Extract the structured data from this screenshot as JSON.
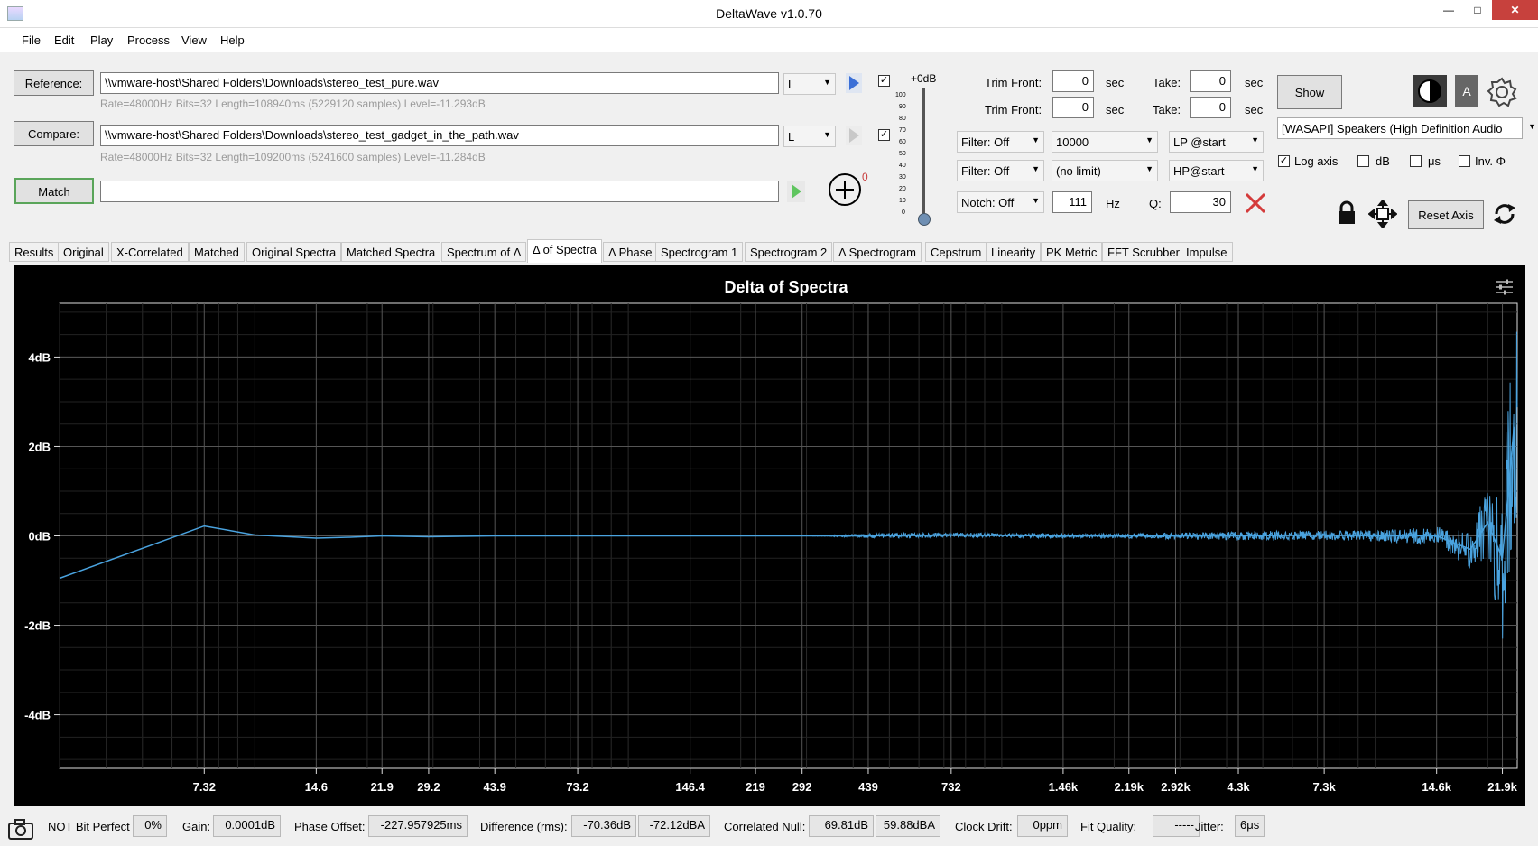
{
  "window": {
    "title": "DeltaWave v1.0.70",
    "minimize": "—",
    "maximize": "□",
    "close": "✕"
  },
  "menu": [
    "File",
    "Edit",
    "Play",
    "Process",
    "View",
    "Help"
  ],
  "reference": {
    "button": "Reference:",
    "path": "\\\\vmware-host\\Shared Folders\\Downloads\\stereo_test_pure.wav",
    "info": "Rate=48000Hz Bits=32 Length=108940ms (5229120 samples) Level=-11.293dB",
    "channel": "L"
  },
  "compare": {
    "button": "Compare:",
    "path": "\\\\vmware-host\\Shared Folders\\Downloads\\stereo_test_gadget_in_the_path.wav",
    "info": "Rate=48000Hz Bits=32 Length=109200ms (5241600 samples) Level=-11.284dB",
    "channel": "L"
  },
  "match": {
    "button": "Match",
    "counter": "0"
  },
  "level": {
    "label": "+0dB",
    "ticks": [
      "100",
      "90",
      "80",
      "70",
      "60",
      "50",
      "40",
      "30",
      "20",
      "10",
      "0"
    ]
  },
  "trim": {
    "rows": [
      {
        "trim_label": "Trim Front:",
        "trim_value": "0",
        "unit": "sec",
        "take_label": "Take:",
        "take_value": "0",
        "take_unit": "sec"
      },
      {
        "trim_label": "Trim Front:",
        "trim_value": "0",
        "unit": "sec",
        "take_label": "Take:",
        "take_value": "0",
        "take_unit": "sec"
      }
    ]
  },
  "filters": {
    "filter1": "Filter: Off",
    "freq1": "10000",
    "mode1": "LP @start",
    "filter2": "Filter: Off",
    "freq2": "(no limit)",
    "mode2": "HP@start",
    "notch": "Notch: Off",
    "notch_freq": "111",
    "hz": "Hz",
    "q_label": "Q:",
    "q_value": "30"
  },
  "right_panel": {
    "show_button": "Show",
    "a_button": "A",
    "device": "[WASAPI] Speakers (High Definition Audio",
    "log_axis": "Log axis",
    "db": "dB",
    "us": "μs",
    "inv": "Inv. Φ",
    "reset_axis": "Reset Axis"
  },
  "tabs": [
    "Results",
    "Original",
    "X-Correlated",
    "Matched",
    "Original Spectra",
    "Matched Spectra",
    "Spectrum of Δ",
    "Δ of Spectra",
    "Δ Phase",
    "Spectrogram 1",
    "Spectrogram 2",
    "Δ Spectrogram",
    "Cepstrum",
    "Linearity",
    "PK Metric",
    "FFT Scrubber",
    "Impulse"
  ],
  "active_tab": "Δ of Spectra",
  "chart_data": {
    "type": "line",
    "title": "Delta of Spectra",
    "x_scale": "log",
    "xlim": [
      3,
      24000
    ],
    "ylim": [
      -5.2,
      5.2
    ],
    "y_ticks": [
      {
        "v": 4,
        "label": "4dB"
      },
      {
        "v": 2,
        "label": "2dB"
      },
      {
        "v": 0,
        "label": "0dB"
      },
      {
        "v": -2,
        "label": "-2dB"
      },
      {
        "v": -4,
        "label": "-4dB"
      }
    ],
    "x_ticks": [
      {
        "v": 7.32,
        "label": "7.32"
      },
      {
        "v": 14.6,
        "label": "14.6"
      },
      {
        "v": 21.9,
        "label": "21.9"
      },
      {
        "v": 29.2,
        "label": "29.2"
      },
      {
        "v": 43.9,
        "label": "43.9"
      },
      {
        "v": 73.2,
        "label": "73.2"
      },
      {
        "v": 146.4,
        "label": "146.4"
      },
      {
        "v": 219,
        "label": "219"
      },
      {
        "v": 292,
        "label": "292"
      },
      {
        "v": 439,
        "label": "439"
      },
      {
        "v": 732,
        "label": "732"
      },
      {
        "v": 1460,
        "label": "1.46k"
      },
      {
        "v": 2190,
        "label": "2.19k"
      },
      {
        "v": 2920,
        "label": "2.92k"
      },
      {
        "v": 4300,
        "label": "4.3k"
      },
      {
        "v": 7300,
        "label": "7.3k"
      },
      {
        "v": 14600,
        "label": "14.6k"
      },
      {
        "v": 21900,
        "label": "21.9k"
      }
    ],
    "grid": true,
    "series": [
      {
        "color": "#4aa3df",
        "x": [
          3,
          7.32,
          10,
          14.6,
          18,
          21.9,
          29.2,
          43.9,
          73.2,
          146.4,
          219,
          292,
          439,
          732,
          1460,
          2190,
          2920,
          4300,
          7300,
          10000,
          14600,
          18000,
          20000,
          21900,
          23500
        ],
        "y": [
          -0.95,
          0.22,
          0.02,
          -0.05,
          -0.03,
          0,
          -0.02,
          0,
          0,
          0,
          0,
          0,
          0,
          0.02,
          0,
          0,
          0,
          0,
          0.02,
          0,
          0,
          -0.3,
          0.3,
          -0.5,
          2.4
        ],
        "noise_envelope": {
          "x": [
            3,
            300,
            500,
            1000,
            2000,
            5000,
            10000,
            14600,
            18000,
            20000,
            21000,
            22000,
            23500
          ],
          "amp": [
            0,
            0,
            0.06,
            0.05,
            0.05,
            0.1,
            0.12,
            0.2,
            0.45,
            0.8,
            1.4,
            1.9,
            2.3
          ]
        }
      }
    ]
  },
  "status": {
    "bit_perfect": "NOT Bit Perfect",
    "bit_perfect_pct": "0%",
    "gain_label": "Gain:",
    "gain": "0.0001dB",
    "phase_label": "Phase Offset:",
    "phase": "-227.957925ms",
    "diff_label": "Difference (rms):",
    "diff_db": "-70.36dB",
    "diff_dba": "-72.12dBA",
    "null_label": "Correlated Null:",
    "null_db": "69.81dB",
    "null_dba": "59.88dBA",
    "drift_label": "Clock Drift:",
    "drift": "0ppm",
    "fit_label": "Fit Quality:",
    "fit": "-----",
    "jitter_label": "Jitter:",
    "jitter": "6μs"
  }
}
